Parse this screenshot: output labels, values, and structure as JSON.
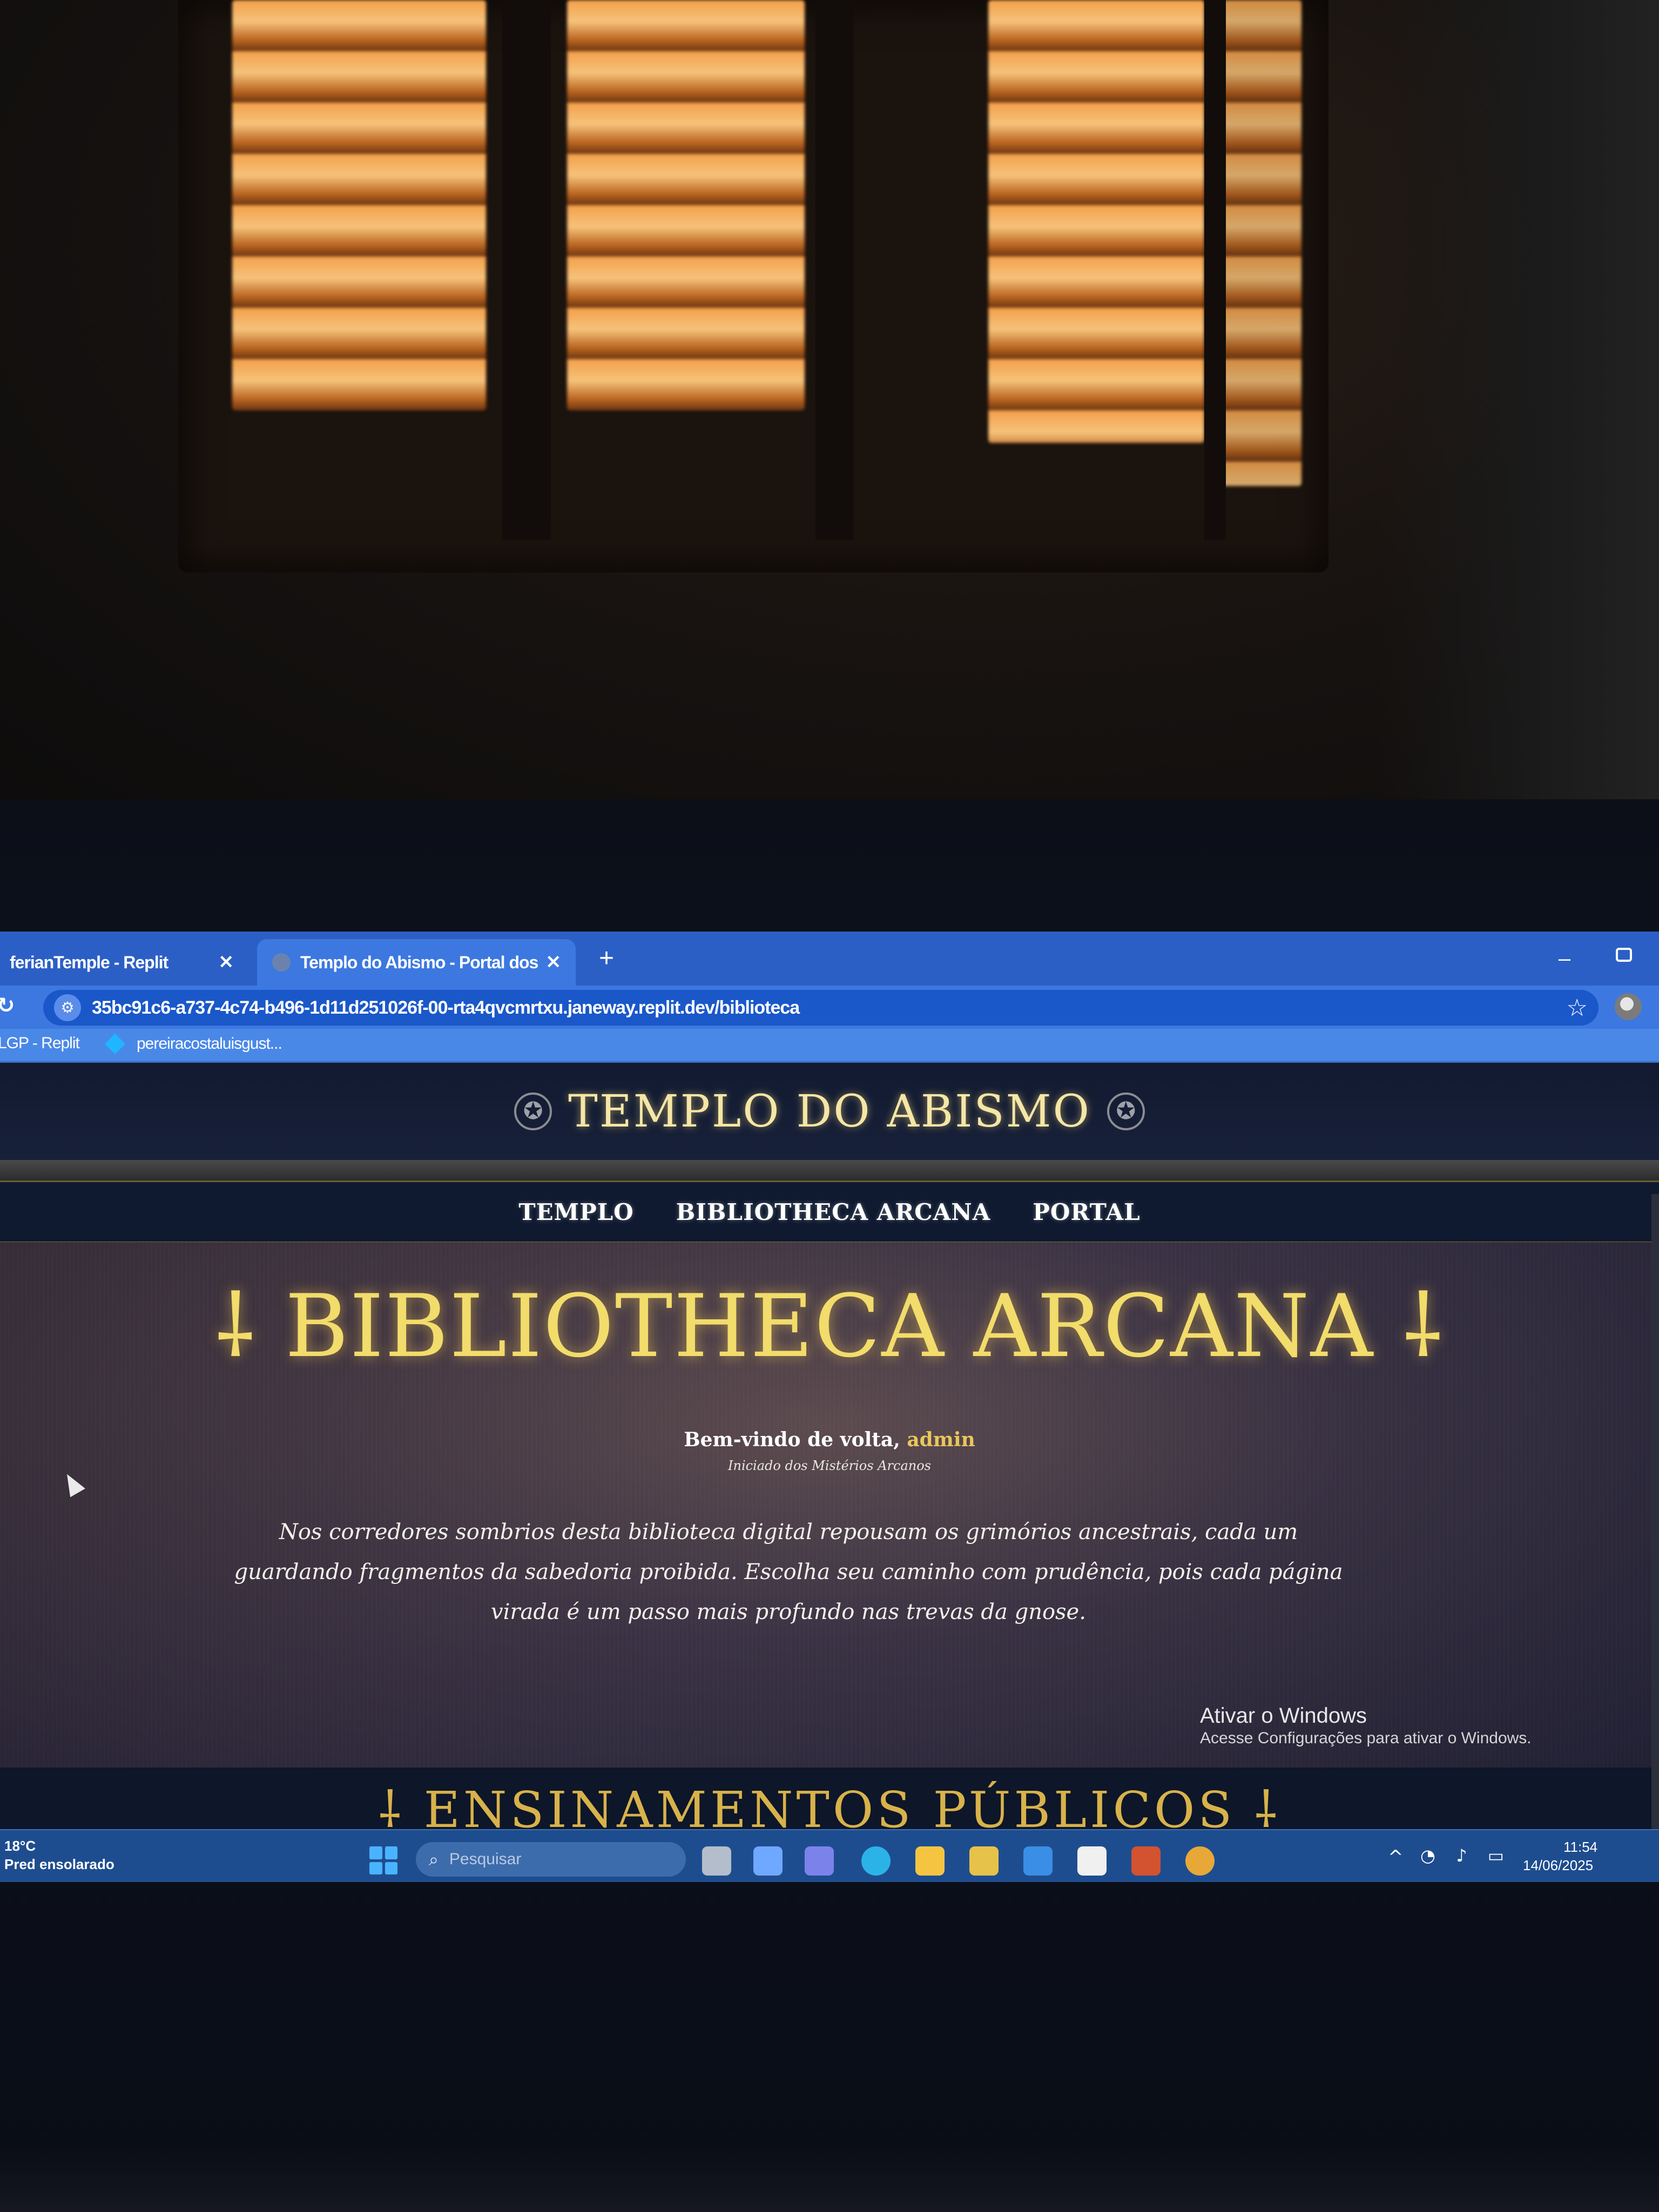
{
  "browser": {
    "tabs": [
      {
        "label": "ferianTemple - Replit",
        "active": false
      },
      {
        "label": "Templo do Abismo - Portal dos",
        "active": true
      }
    ],
    "new_tab_symbol": "+",
    "close_symbol": "✕",
    "url": "35bc91c6-a737-4c74-b496-1d11d251026f-00-rta4qvcmrtxu.janeway.replit.dev/biblioteca",
    "bookmarks": [
      {
        "label": "LGP - Replit"
      },
      {
        "label": "pereiracostaluisgust..."
      }
    ]
  },
  "site": {
    "title": "TEMPLO DO ABISMO",
    "nav": [
      {
        "label": "TEMPLO"
      },
      {
        "label": "BIBLIOTHECA ARCANA"
      },
      {
        "label": "PORTAL"
      }
    ],
    "heading": "⸸ BIBLIOTHECA ARCANA ⸸",
    "welcome_prefix": "Bem-vindo de volta, ",
    "welcome_user": "admin",
    "rank": "Iniciado dos Mistérios Arcanos",
    "intro": "Nos corredores sombrios desta biblioteca digital repousam os grimórios ancestrais, cada um guardando fragmentos da sabedoria proibida. Escolha seu caminho com prudência, pois cada página virada é um passo mais profundo nas trevas da gnose.",
    "section_heading": "⸸ ENSINAMENTOS PÚBLICOS ⸸"
  },
  "windows_watermark": {
    "title": "Ativar o Windows",
    "subtitle": "Acesse Configurações para ativar o Windows."
  },
  "taskbar": {
    "weather_temp": "18°C",
    "weather_desc": "Pred ensolarado",
    "search_placeholder": "Pesquisar",
    "time": "11:54",
    "date": "14/06/2025"
  },
  "colors": {
    "accent_gold": "#f2dc6b",
    "browser_blue": "#3c78e0",
    "site_header": "#111a30"
  }
}
